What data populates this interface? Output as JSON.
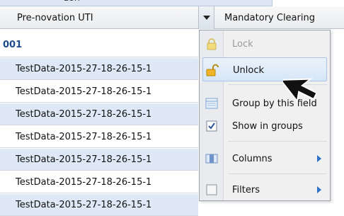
{
  "top": {
    "partial_text": "EUR"
  },
  "header": {
    "col1_label": "Pre-novation UTI",
    "col2_label": "Mandatory Clearing"
  },
  "group": {
    "label": "001"
  },
  "rows": [
    {
      "value": "TestData-2015-27-18-26-15-1"
    },
    {
      "value": "TestData-2015-27-18-26-15-1"
    },
    {
      "value": "TestData-2015-27-18-26-15-1"
    },
    {
      "value": "TestData-2015-27-18-26-15-1"
    },
    {
      "value": "TestData-2015-27-18-26-15-1"
    },
    {
      "value": "TestData-2015-27-18-26-15-1"
    },
    {
      "value": "TestData-2015-27-18-26-15-1"
    }
  ],
  "menu": {
    "items": [
      {
        "label": "Lock",
        "icon": "lock-icon",
        "disabled": true
      },
      {
        "label": "Unlock",
        "icon": "unlock-icon",
        "active": true
      },
      {
        "label": "Group by this field",
        "icon": "group-icon"
      },
      {
        "label": "Show in groups",
        "icon": "checkbox-checked-icon",
        "checked": true
      },
      {
        "label": "Columns",
        "icon": "columns-icon",
        "submenu": true
      },
      {
        "label": "Filters",
        "icon": "checkbox-empty-icon",
        "submenu": true
      }
    ]
  },
  "colors": {
    "accent": "#2e72c6",
    "row_alt": "#dfe8f6",
    "group_text": "#1d4a8c"
  }
}
